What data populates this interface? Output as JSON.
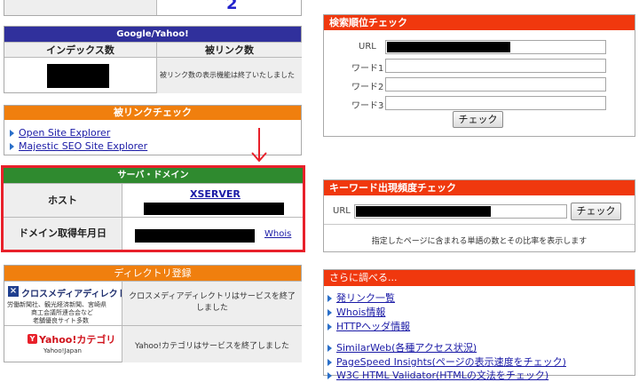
{
  "top_stub": {
    "letter": "2"
  },
  "google_yahoo": {
    "title": "Google/Yahoo!",
    "col_index": "インデックス数",
    "col_backlinks": "被リンク数",
    "backlinks_note": "被リンク数の表示機能は終了いたしました"
  },
  "backlink_check": {
    "title": "被リンクチェック",
    "links": [
      "Open Site Explorer",
      "Majestic SEO Site Explorer"
    ]
  },
  "server_domain": {
    "title": "サーバ・ドメイン",
    "host_label": "ホスト",
    "host_value": "XSERVER",
    "domain_date_label": "ドメイン取得年月日",
    "whois_link": "Whois"
  },
  "directory": {
    "title": "ディレクトリ登録",
    "crossmedia_name": "クロスメディアディレクトリ",
    "crossmedia_sub": [
      "労働新聞社、観光経済新聞、宮崎県",
      "商工会議所連合会など",
      "老舗優良サイト多数"
    ],
    "crossmedia_status": "クロスメディアディレクトリはサービスを終了しました",
    "yahoo_name": "Yahoo!カテゴリ",
    "yahoo_sub": "Yahoo!Japan",
    "yahoo_status": "Yahoo!カテゴリはサービスを終了しました"
  },
  "rank_check": {
    "title": "検索順位チェック",
    "url_label": "URL",
    "word1_label": "ワード1",
    "word2_label": "ワード2",
    "word3_label": "ワード3",
    "check_button": "チェック"
  },
  "keyword_density": {
    "title": "キーワード出現頻度チェック",
    "url_label": "URL",
    "check_button": "チェック",
    "description": "指定したページに含まれる単語の数とその比率を表示します"
  },
  "more": {
    "title": "さらに調べる...",
    "links": [
      "発リンク一覧",
      "Whois情報",
      "HTTPヘッダ情報",
      "SimilarWeb(各種アクセス状況)",
      "PageSpeed Insights(ページの表示速度をチェック)",
      "W3C HTML Validator(HTMLの文法をチェック)"
    ]
  },
  "colors": {
    "google_bar": "#30309c",
    "orange_bar": "#f07f0e",
    "green_bar": "#2f8a2f",
    "red_bar": "#f0380e",
    "highlight_border": "#e8202a",
    "arrow": "#e8202a"
  },
  "icons": [
    "arrow-down-icon",
    "crossmedia-logo-icon",
    "yahoo-logo-icon",
    "link-bullet-icon"
  ]
}
